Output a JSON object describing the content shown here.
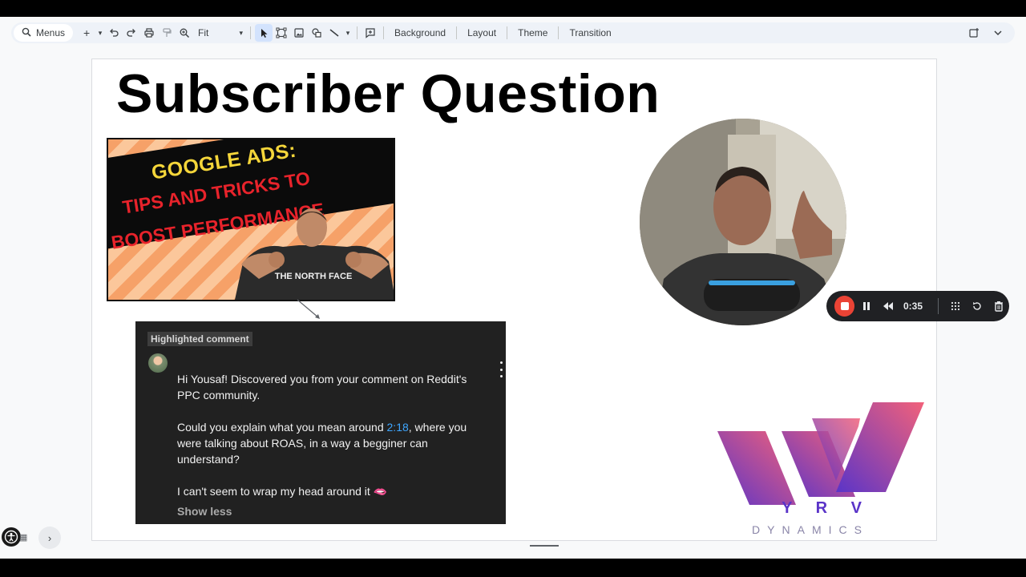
{
  "toolbar": {
    "menus_label": "Menus",
    "zoom_value": "Fit",
    "buttons": [
      "Background",
      "Layout",
      "Theme",
      "Transition"
    ]
  },
  "slide": {
    "title": "Subscriber Question",
    "thumbnail": {
      "line1": "GOOGLE ADS:",
      "line2": "TIPS AND TRICKS TO",
      "line3": "BOOST PERFORMANCE",
      "shirt": "THE NORTH FACE"
    },
    "comment": {
      "badge": "Highlighted comment",
      "para1": "Hi Yousaf! Discovered you from your comment on Reddit's PPC community.",
      "para2_before": "Could you explain what you mean around ",
      "para2_time": "2:18",
      "para2_after": ", where you were talking about ROAS, in a way a begginer can understand?",
      "para3": "I can't seem to wrap my head around it",
      "para3_emoji": "🫦",
      "show_less": "Show less"
    },
    "logo": {
      "letters": "Y R V",
      "subtitle": "DYNAMICS"
    }
  },
  "recording": {
    "time": "0:35"
  },
  "colors": {
    "accent_blue": "#3ea6ff",
    "record_red": "#ea4335",
    "logo_purple": "#6a3fd0",
    "logo_pink": "#ef5a7a"
  }
}
